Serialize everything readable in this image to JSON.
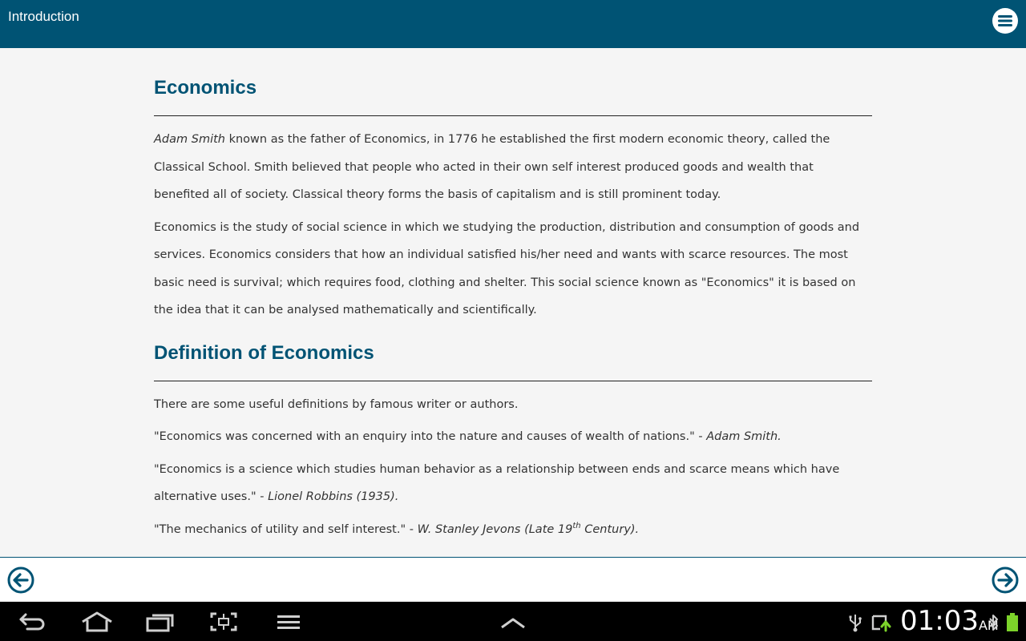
{
  "header": {
    "title": "Introduction",
    "menu_icon": "menu-icon"
  },
  "sections": [
    {
      "heading": "Economics",
      "paragraphs": [
        {
          "lead_italic": "Adam Smith",
          "text": " known as the father of Economics, in 1776 he established the first modern economic theory, called the Classical School. Smith believed that people who acted in their own self interest produced goods and wealth that benefited all of society. Classical theory forms the basis of capitalism and is still prominent today."
        },
        {
          "text": "Economics is the study of social science in which we studying the production, distribution and consumption of goods and services. Economics considers that how an individual satisfied his/her need and wants with scarce resources.  The most basic need is survival; which requires food, clothing and shelter. This social science known as \"Economics\" it is based on the idea that it can be analysed mathematically and scientifically."
        }
      ]
    },
    {
      "heading": "Definition of Economics",
      "intro": "There are some useful definitions by famous writer or authors.",
      "quotes": [
        {
          "text": "\"Economics was concerned with an enquiry into the nature and causes of wealth of nations.\" - ",
          "author": "Adam Smith."
        },
        {
          "text": "\"Economics is a science which studies human behavior as a relationship between ends and scarce means which have alternative uses.\" - ",
          "author": "Lionel Robbins (1935)."
        },
        {
          "text": "\"The mechanics of utility and self interest.\" - ",
          "author_pre": "W. Stanley Jevons (Late 19",
          "author_sup": "th",
          "author_post": " Century)."
        }
      ]
    }
  ],
  "nav": {
    "prev_icon": "arrow-left-circle-icon",
    "next_icon": "arrow-right-circle-icon"
  },
  "system_bar": {
    "time": "01:03",
    "ampm": "AM",
    "icons": [
      "back-icon",
      "home-icon",
      "recent-apps-icon",
      "screenshot-icon",
      "menu-lines-icon",
      "chevron-up-icon",
      "usb-icon",
      "sync-icon",
      "bluetooth-icon",
      "battery-icon"
    ],
    "colors": {
      "battery": "#7cd32a",
      "accent": "#005374"
    }
  }
}
